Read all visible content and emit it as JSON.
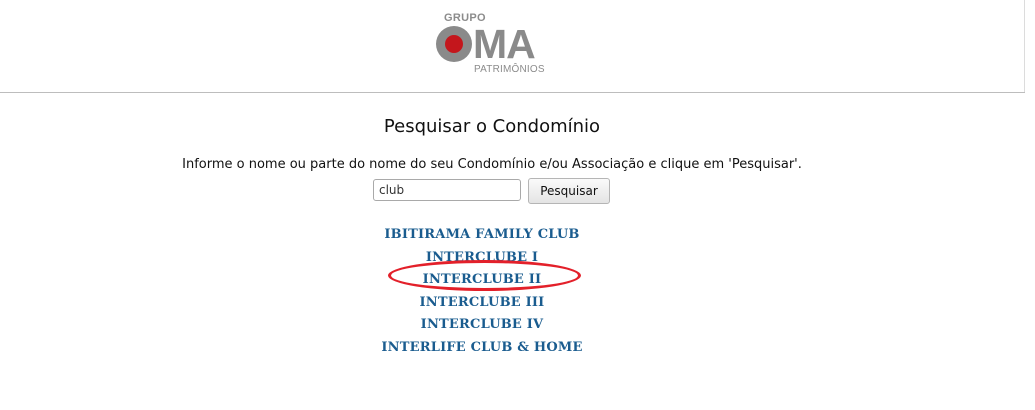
{
  "logo": {
    "top_text": "GRUPO",
    "brand_rest": "MA",
    "bottom_text": "PATRIMÔNIOS"
  },
  "search": {
    "title": "Pesquisar o Condomínio",
    "instructions": "Informe o nome ou parte do nome do seu Condomínio e/ou Associação e clique em 'Pesquisar'.",
    "input_value": "club",
    "button_label": "Pesquisar"
  },
  "results": [
    {
      "label": "IBITIRAMA FAMILY CLUB"
    },
    {
      "label": "INTERCLUBE I"
    },
    {
      "label": "INTERCLUBE II",
      "highlighted": true
    },
    {
      "label": "INTERCLUBE III"
    },
    {
      "label": "INTERCLUBE IV"
    },
    {
      "label": "INTERLIFE CLUB & HOME"
    }
  ],
  "colors": {
    "link": "#1a5c8f",
    "highlight_ring": "#e3202a",
    "logo_gray": "#8a8a8a",
    "logo_red": "#c4161c"
  }
}
